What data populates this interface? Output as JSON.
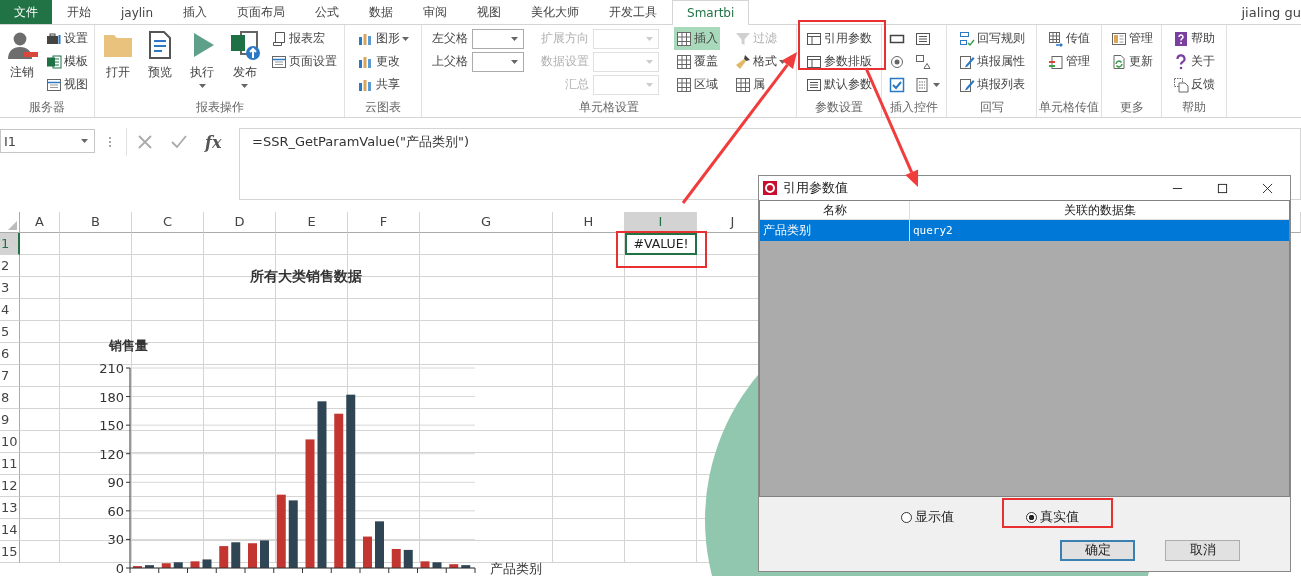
{
  "tabs": [
    {
      "label": "文件",
      "kind": "file",
      "selected": false
    },
    {
      "label": "开始",
      "kind": "tab",
      "selected": false
    },
    {
      "label": "jaylin",
      "kind": "tab",
      "selected": false
    },
    {
      "label": "插入",
      "kind": "tab",
      "selected": false
    },
    {
      "label": "页面布局",
      "kind": "tab",
      "selected": false
    },
    {
      "label": "公式",
      "kind": "tab",
      "selected": false
    },
    {
      "label": "数据",
      "kind": "tab",
      "selected": false
    },
    {
      "label": "审阅",
      "kind": "tab",
      "selected": false
    },
    {
      "label": "视图",
      "kind": "tab",
      "selected": false
    },
    {
      "label": "美化大师",
      "kind": "tab",
      "selected": false
    },
    {
      "label": "开发工具",
      "kind": "tab",
      "selected": false
    },
    {
      "label": "Smartbi",
      "kind": "tab",
      "selected": true
    }
  ],
  "user": "jialing gu",
  "ribbon": {
    "groups": [
      {
        "label": "服务器",
        "columns": [
          [
            {
              "kind": "large",
              "label": "注销",
              "dropdown": false,
              "disabled": false
            }
          ],
          [
            {
              "kind": "small",
              "label": "设置",
              "dropdown": false,
              "disabled": false
            },
            {
              "kind": "small",
              "label": "模板",
              "dropdown": false,
              "disabled": false
            },
            {
              "kind": "small",
              "label": "视图",
              "dropdown": false,
              "disabled": false
            }
          ]
        ]
      },
      {
        "label": "报表操作",
        "columns": [
          [
            {
              "kind": "large",
              "label": "打开",
              "dropdown": false,
              "disabled": false
            }
          ],
          [
            {
              "kind": "large",
              "label": "预览",
              "dropdown": false,
              "disabled": false
            }
          ],
          [
            {
              "kind": "large",
              "label": "执行",
              "dropdown": true,
              "disabled": false
            }
          ],
          [
            {
              "kind": "large",
              "label": "发布",
              "dropdown": true,
              "disabled": false
            }
          ],
          [
            {
              "kind": "small",
              "label": "报表宏",
              "dropdown": false,
              "disabled": false
            },
            {
              "kind": "small",
              "label": "页面设置",
              "dropdown": false,
              "disabled": false
            }
          ]
        ]
      },
      {
        "label": "云图表",
        "columns": [
          [
            {
              "kind": "small",
              "label": "图形",
              "dropdown": true,
              "disabled": false
            },
            {
              "kind": "small",
              "label": "更改",
              "dropdown": false,
              "disabled": false
            },
            {
              "kind": "small",
              "label": "共享",
              "dropdown": false,
              "disabled": false
            }
          ]
        ]
      },
      {
        "label": "单元格设置",
        "columns": [
          [
            {
              "kind": "field",
              "label": "左父格",
              "disabled": false
            },
            {
              "kind": "field",
              "label": "上父格",
              "disabled": false
            }
          ],
          [
            {
              "kind": "field",
              "label": "扩展方向",
              "disabled": true
            },
            {
              "kind": "field",
              "label": "数据设置",
              "disabled": true
            },
            {
              "kind": "field",
              "label": "汇总",
              "disabled": true
            }
          ],
          [
            {
              "kind": "small",
              "label": "插入",
              "dropdown": false,
              "disabled": false,
              "on": true
            },
            {
              "kind": "small",
              "label": "覆盖",
              "dropdown": false,
              "disabled": false,
              "on": false
            },
            {
              "kind": "small",
              "label": "区域",
              "dropdown": false,
              "disabled": false,
              "on": false
            }
          ],
          [
            {
              "kind": "small",
              "label": "过滤",
              "dropdown": false,
              "disabled": true
            },
            {
              "kind": "small",
              "label": "格式",
              "dropdown": true,
              "disabled": false
            },
            {
              "kind": "small",
              "label": "属",
              "dropdown": false,
              "disabled": false
            }
          ]
        ]
      },
      {
        "label": "参数设置",
        "columns": [
          [
            {
              "kind": "small",
              "label": "引用参数",
              "dropdown": false,
              "disabled": false
            },
            {
              "kind": "small",
              "label": "参数排版",
              "dropdown": false,
              "disabled": false
            },
            {
              "kind": "small",
              "label": "默认参数",
              "dropdown": false,
              "disabled": false
            }
          ]
        ]
      },
      {
        "label": "插入控件",
        "columns": [
          [
            {
              "kind": "icon",
              "dropdown": false,
              "disabled": false
            },
            {
              "kind": "icon",
              "dropdown": false,
              "disabled": false
            },
            {
              "kind": "icon",
              "dropdown": false,
              "disabled": false
            }
          ],
          [
            {
              "kind": "icon",
              "dropdown": false,
              "disabled": false
            },
            {
              "kind": "icon",
              "dropdown": false,
              "disabled": false
            },
            {
              "kind": "icon",
              "dropdown": true,
              "disabled": false
            }
          ]
        ]
      },
      {
        "label": "回写",
        "columns": [
          [
            {
              "kind": "small",
              "label": "回写规则",
              "dropdown": false,
              "disabled": false
            },
            {
              "kind": "small",
              "label": "填报属性",
              "dropdown": false,
              "disabled": false
            },
            {
              "kind": "small",
              "label": "填报列表",
              "dropdown": false,
              "disabled": false
            }
          ]
        ]
      },
      {
        "label": "单元格传值",
        "columns": [
          [
            {
              "kind": "small",
              "label": "传值",
              "dropdown": false,
              "disabled": false
            },
            {
              "kind": "small",
              "label": "管理",
              "dropdown": false,
              "disabled": false
            }
          ]
        ]
      },
      {
        "label": "更多",
        "columns": [
          [
            {
              "kind": "small",
              "label": "管理",
              "dropdown": false,
              "disabled": false
            },
            {
              "kind": "small",
              "label": "更新",
              "dropdown": false,
              "disabled": false
            }
          ]
        ]
      },
      {
        "label": "帮助",
        "columns": [
          [
            {
              "kind": "small",
              "label": "帮助",
              "dropdown": false,
              "disabled": false
            },
            {
              "kind": "small",
              "label": "关于",
              "dropdown": false,
              "disabled": false
            },
            {
              "kind": "small",
              "label": "反馈",
              "dropdown": false,
              "disabled": false
            }
          ]
        ]
      }
    ]
  },
  "sheet": {
    "name_box": "I1",
    "function_button": "fx",
    "formula": "=SSR_GetParamValue(\"产品类别\")",
    "columns": [
      {
        "label": "A",
        "selected": false
      },
      {
        "label": "B",
        "selected": false
      },
      {
        "label": "C",
        "selected": false
      },
      {
        "label": "D",
        "selected": false
      },
      {
        "label": "E",
        "selected": false
      },
      {
        "label": "F",
        "selected": false
      },
      {
        "label": "G",
        "selected": false
      },
      {
        "label": "H",
        "selected": false
      },
      {
        "label": "I",
        "selected": true
      },
      {
        "label": "J",
        "selected": false
      }
    ],
    "rows": [
      {
        "label": "1",
        "selected": true
      },
      {
        "label": "2",
        "selected": false
      },
      {
        "label": "3",
        "selected": false
      },
      {
        "label": "4",
        "selected": false
      },
      {
        "label": "5",
        "selected": false
      },
      {
        "label": "6",
        "selected": false
      },
      {
        "label": "7",
        "selected": false
      },
      {
        "label": "8",
        "selected": false
      },
      {
        "label": "9",
        "selected": false
      },
      {
        "label": "10",
        "selected": false
      },
      {
        "label": "11",
        "selected": false
      },
      {
        "label": "12",
        "selected": false
      },
      {
        "label": "13",
        "selected": false
      },
      {
        "label": "14",
        "selected": false
      },
      {
        "label": "15",
        "selected": false
      }
    ],
    "active_cell_value": "#VALUE!",
    "chart": {
      "chart_data": {
        "type": "bar",
        "grid": true,
        "title": "所有大类销售数据",
        "xlabel": "产品类别",
        "ylabel": "销售量",
        "ylim": [
          0,
          210
        ],
        "yticks": [
          0,
          30,
          60,
          90,
          120,
          150,
          180,
          210
        ],
        "series": [
          {
            "color": "#c23531",
            "values": [
              2,
              5,
              7,
              23,
              26,
              77,
              135,
              162,
              33,
              20,
              7,
              4
            ]
          },
          {
            "color": "#2f4554",
            "values": [
              3,
              6,
              9,
              27,
              29,
              71,
              175,
              182,
              49,
              19,
              6,
              3
            ]
          }
        ]
      }
    }
  },
  "dialog": {
    "title": "引用参数值",
    "columns": [
      "名称",
      "关联的数据集"
    ],
    "rows": [
      {
        "cells": [
          "产品类别",
          "query2"
        ],
        "selected": true
      }
    ],
    "options": [
      {
        "label": "显示值",
        "selected": false
      },
      {
        "label": "真实值",
        "selected": true
      }
    ],
    "buttons": [
      {
        "label": "确定",
        "kind": "default"
      },
      {
        "label": "取消",
        "kind": "normal"
      }
    ]
  }
}
